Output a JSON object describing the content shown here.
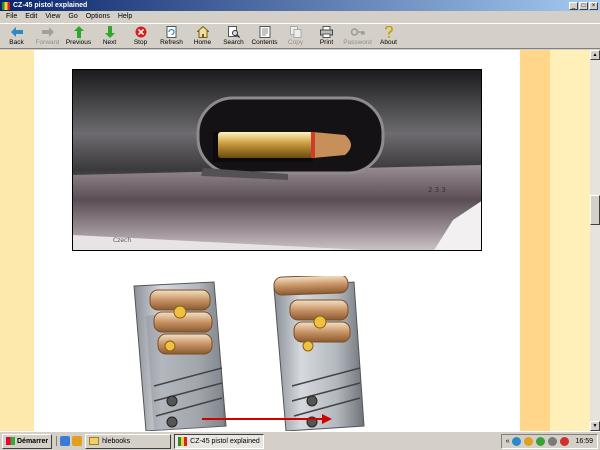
{
  "window": {
    "title": "CZ-45 pistol explained"
  },
  "menu": [
    "File",
    "Edit",
    "View",
    "Go",
    "Options",
    "Help"
  ],
  "toolbar": [
    {
      "label": "Back",
      "icon": "back-arrow-icon",
      "enabled": true
    },
    {
      "label": "Forward",
      "icon": "forward-arrow-icon",
      "enabled": false
    },
    {
      "label": "Previous",
      "icon": "up-arrow-icon",
      "enabled": true
    },
    {
      "label": "Next",
      "icon": "down-arrow-icon",
      "enabled": true
    },
    {
      "label": "Stop",
      "icon": "stop-icon",
      "enabled": true
    },
    {
      "label": "Refresh",
      "icon": "refresh-icon",
      "enabled": true
    },
    {
      "label": "Home",
      "icon": "home-icon",
      "enabled": true
    },
    {
      "label": "Search",
      "icon": "search-icon",
      "enabled": true
    },
    {
      "label": "Contents",
      "icon": "contents-icon",
      "enabled": true
    },
    {
      "label": "Copy",
      "icon": "copy-icon",
      "enabled": false
    },
    {
      "label": "Print",
      "icon": "print-icon",
      "enabled": true
    },
    {
      "label": "Password",
      "icon": "key-icon",
      "enabled": false
    },
    {
      "label": "About",
      "icon": "about-icon",
      "enabled": true
    }
  ],
  "taskbar": {
    "start_label": "Démarrer",
    "tasks": [
      {
        "label": "hlebooks",
        "icon": "folder-icon",
        "active": false
      },
      {
        "label": "CZ-45 pistol explained",
        "icon": "app-icon",
        "active": true
      }
    ],
    "clock": "16:59"
  },
  "colors": {
    "accent_titlebar": "#0a246a",
    "page_white": "#ffffff",
    "stripe_left": "#fde9ab",
    "stripe_right": "#ffd68a",
    "arrow_red": "#d00000"
  }
}
